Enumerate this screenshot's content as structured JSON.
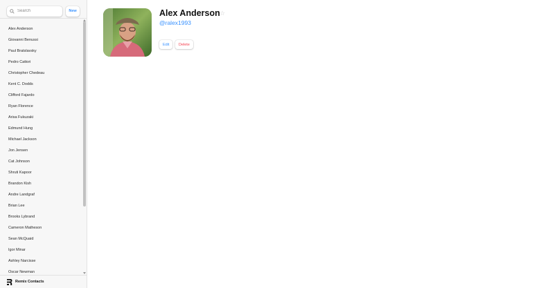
{
  "search": {
    "placeholder": "Search"
  },
  "new_button_label": "New",
  "contacts": [
    "Alex Anderson",
    "Giovanni Benussi",
    "Paul Bratslavsky",
    "Pedro Cattori",
    "Christopher Chedeau",
    "Kent C. Dodds",
    "Clifford Fajardo",
    "Ryan Florence",
    "Arisa Fukuzaki",
    "Edmund Hung",
    "Michael Jackson",
    "Jon Jensen",
    "Cat Johnson",
    "Shruti Kapoor",
    "Brandon Kish",
    "Andre Landgraf",
    "Brian Lee",
    "Brooks Lybrand",
    "Cameron Matheson",
    "Sean McQuaid",
    "Igor Minar",
    "Ashley Narcisse",
    "Oscar Newman"
  ],
  "footer": {
    "title": "Remix Contacts",
    "icon": "remix-logo-icon"
  },
  "detail": {
    "name": "Alex Anderson",
    "favorite_icon": "☆",
    "twitter": "@ralex1993",
    "edit_label": "Edit",
    "delete_label": "Delete"
  },
  "colors": {
    "accent": "#3992ff",
    "danger": "#f44250",
    "sidebar_bg": "#f7f7f7"
  }
}
